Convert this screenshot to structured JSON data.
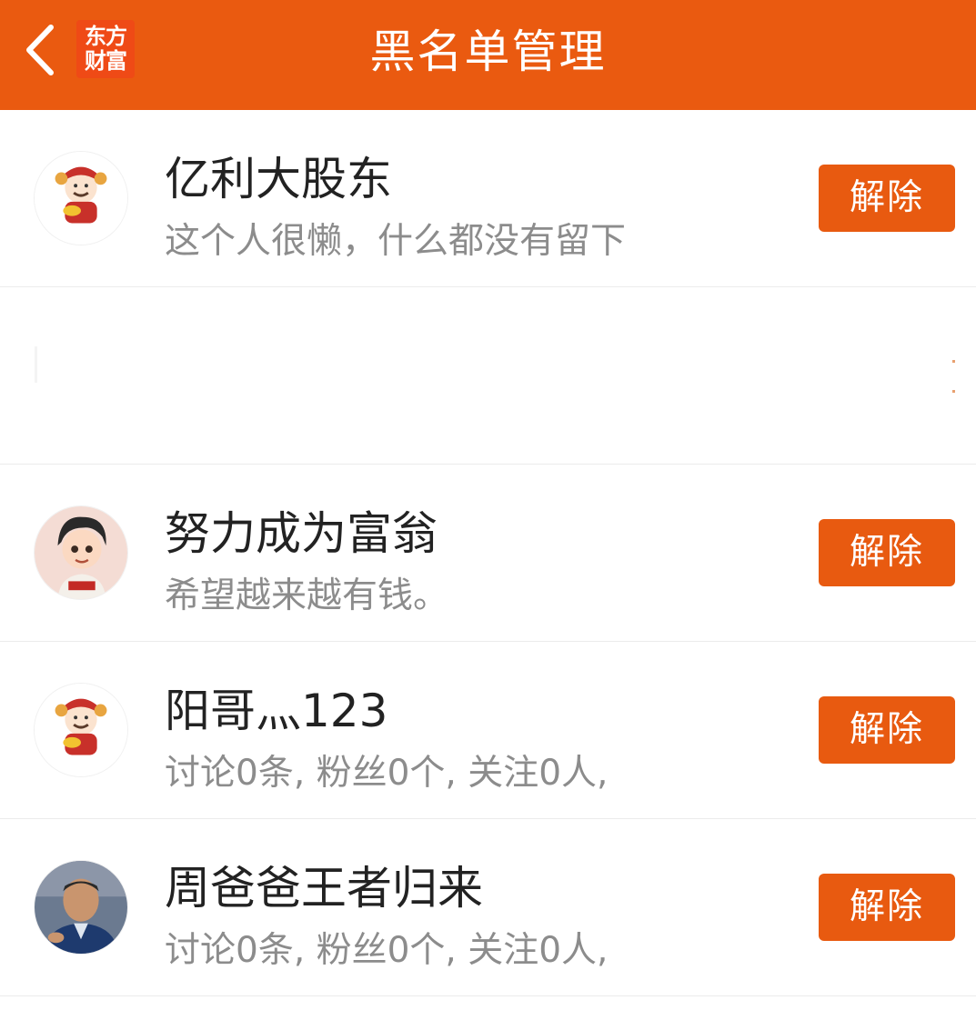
{
  "header": {
    "title": "黑名单管理",
    "logo_line1": "东方",
    "logo_line2": "财富",
    "back_icon": "chevron-left-icon",
    "bg_color": "#ea5a10"
  },
  "accent_color": "#e85a10",
  "users": [
    {
      "name": "亿利大股东",
      "subtitle": "这个人很懒，什么都没有留下",
      "avatar": "mascot-avatar",
      "button": "解除"
    },
    {
      "name": "",
      "subtitle": "",
      "avatar": "",
      "button": ""
    },
    {
      "name": "努力成为富翁",
      "subtitle": "希望越来越有钱。",
      "avatar": "cartoon-boy-avatar",
      "button": "解除"
    },
    {
      "name": "阳哥灬123",
      "subtitle": "讨论0条, 粉丝0个, 关注0人,",
      "avatar": "mascot-avatar",
      "button": "解除"
    },
    {
      "name": "周爸爸王者归来",
      "subtitle": "讨论0条, 粉丝0个, 关注0人,",
      "avatar": "photo-avatar",
      "button": "解除"
    }
  ]
}
